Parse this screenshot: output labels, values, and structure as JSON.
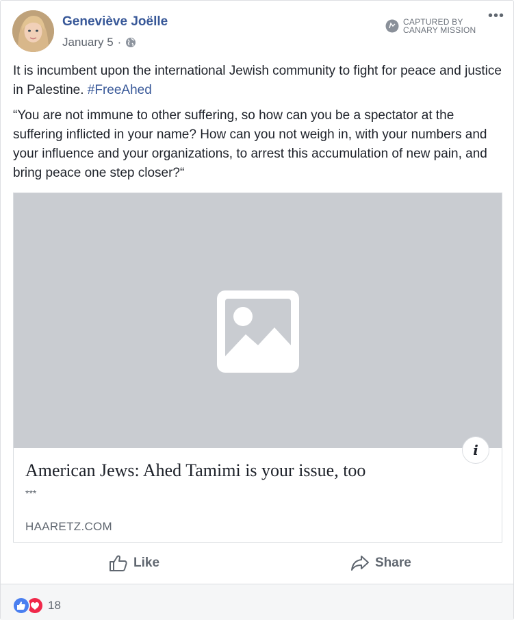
{
  "post": {
    "author": "Geneviève Joëlle",
    "date": "January 5",
    "separator": "·",
    "captured_line1": "CAPTURED BY",
    "captured_line2": "CANARY MISSION",
    "more_label": "•••",
    "text_main": "It is incumbent upon the international Jewish community to fight for peace and justice in Palestine. ",
    "hashtag": "#FreeAhed",
    "quote": "“You are not immune to other suffering, so how can you be a spectator at the suffering inflicted in your name? How can you not weigh in, with your numbers and your influence and your organizations, to arrest this accumulation of new pain, and bring peace one step closer?“"
  },
  "link_card": {
    "title": "American Jews: Ahed Tamimi is your issue, too",
    "description": "***",
    "domain": "HAARETZ.COM",
    "info_label": "i"
  },
  "actions": {
    "like_label": "Like",
    "share_label": "Share"
  },
  "reactions": {
    "count": "18",
    "types": [
      "like-icon",
      "love-icon"
    ]
  },
  "colors": {
    "link_blue": "#385898",
    "placeholder_gray": "#c9ccd1",
    "like_blue": "#4a7ff0",
    "love_red": "#f0284a"
  }
}
